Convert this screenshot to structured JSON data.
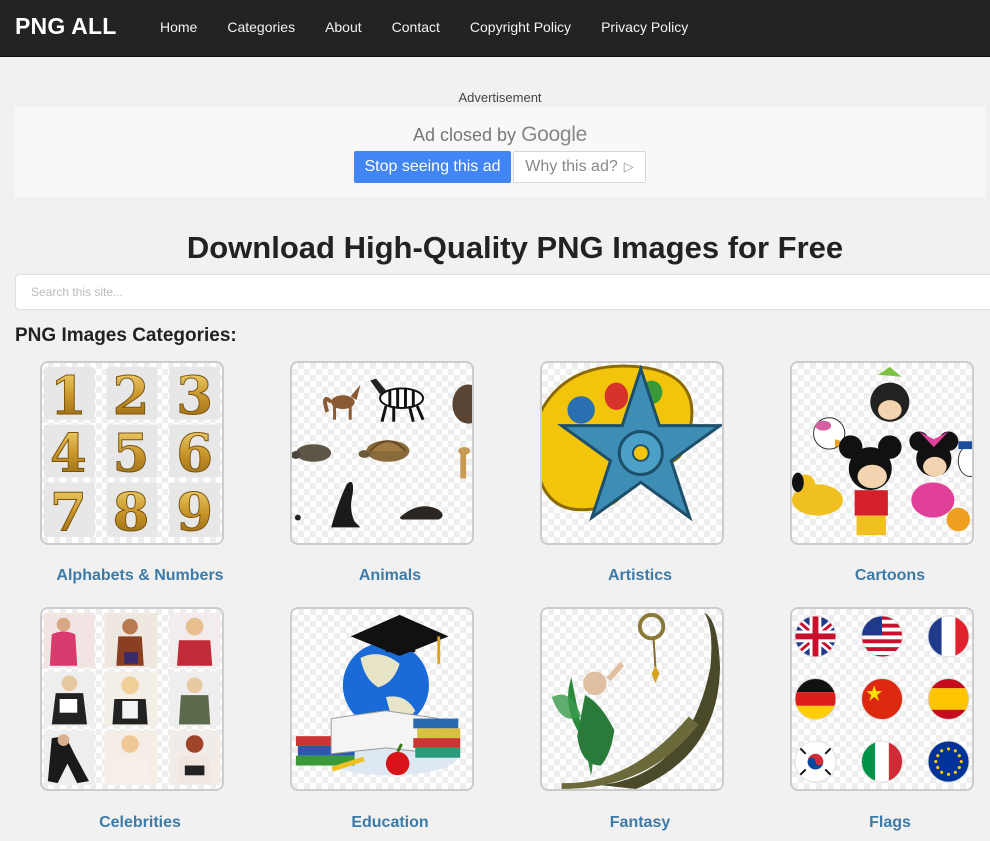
{
  "header": {
    "logo": "PNG ALL",
    "nav": [
      "Home",
      "Categories",
      "About",
      "Contact",
      "Copyright Policy",
      "Privacy Policy"
    ]
  },
  "ad": {
    "label": "Advertisement",
    "closed_prefix": "Ad closed by",
    "closed_brand": "Google",
    "stop_button": "Stop seeing this ad",
    "why_button": "Why this ad?"
  },
  "headline": "Download High-Quality PNG Images for Free",
  "search": {
    "placeholder": "Search this site..."
  },
  "categories_heading": "PNG Images Categories:",
  "categories": [
    {
      "label": "Alphabets & Numbers",
      "digits": [
        "1",
        "2",
        "3",
        "4",
        "5",
        "6",
        "7",
        "8",
        "9"
      ]
    },
    {
      "label": "Animals"
    },
    {
      "label": "Artistics"
    },
    {
      "label": "Cartoons"
    },
    {
      "label": "Celebrities"
    },
    {
      "label": "Education"
    },
    {
      "label": "Fantasy"
    },
    {
      "label": "Flags"
    }
  ],
  "colors": {
    "link": "#3e7aa6",
    "topbar": "#232323",
    "google_blue": "#4285f4"
  }
}
